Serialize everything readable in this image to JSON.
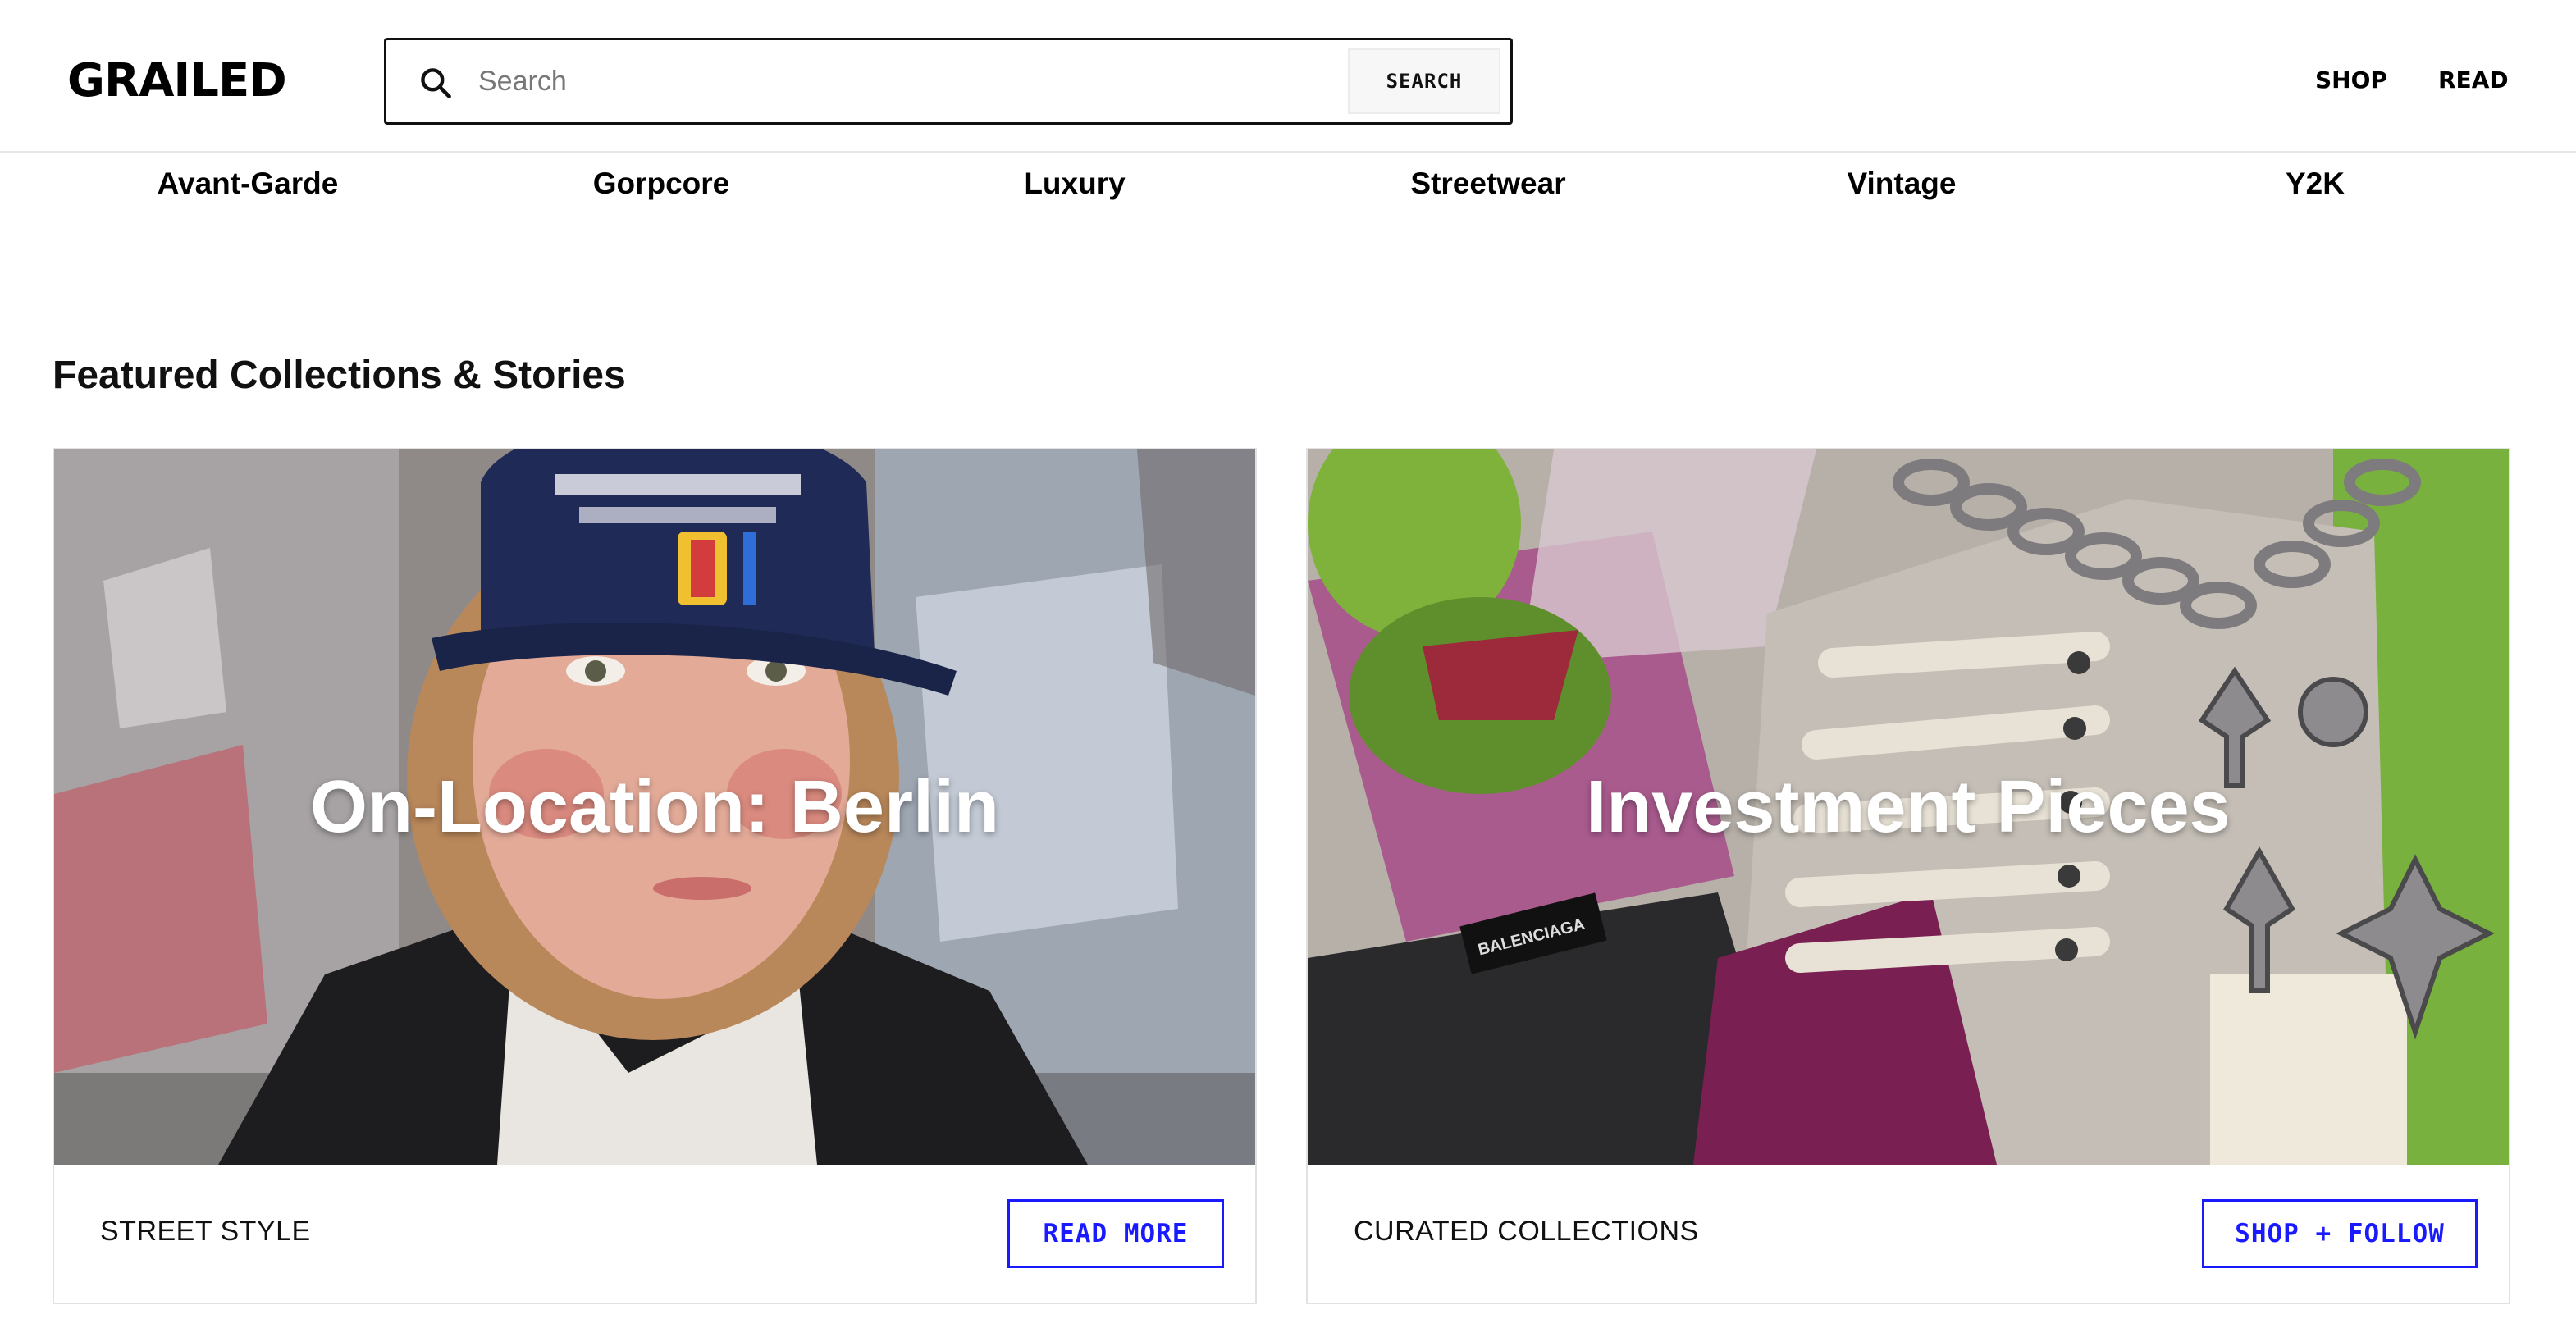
{
  "header": {
    "logo": "GRAILED",
    "search": {
      "placeholder": "Search",
      "value": "",
      "button_label": "SEARCH",
      "icon": "search-icon"
    },
    "nav": [
      {
        "label": "SHOP"
      },
      {
        "label": "READ"
      }
    ]
  },
  "categories": [
    {
      "label": "Avant-Garde"
    },
    {
      "label": "Gorpcore"
    },
    {
      "label": "Luxury"
    },
    {
      "label": "Streetwear"
    },
    {
      "label": "Vintage"
    },
    {
      "label": "Y2K"
    }
  ],
  "featured": {
    "title": "Featured Collections & Stories",
    "cards": [
      {
        "title": "On-Location: Berlin",
        "category": "STREET STYLE",
        "cta": "READ MORE"
      },
      {
        "title": "Investment Pieces",
        "category": "CURATED COLLECTIONS",
        "cta": "SHOP + FOLLOW"
      }
    ]
  },
  "colors": {
    "accent": "#1a1aff",
    "text": "#111111",
    "divider": "#e6e6e6"
  }
}
